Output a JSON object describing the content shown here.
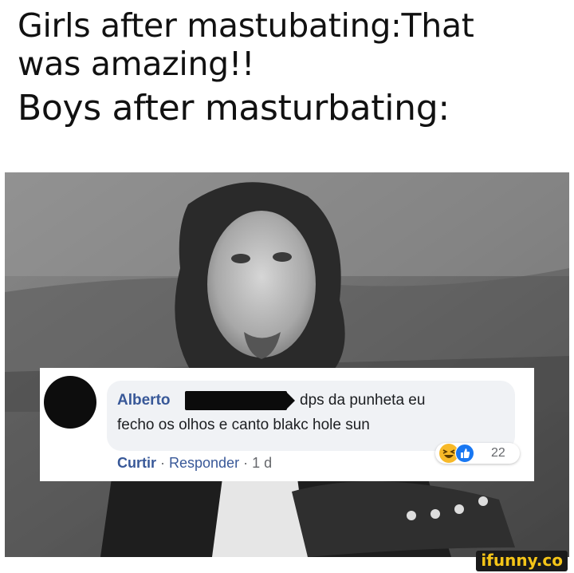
{
  "caption": {
    "line1": "Girls after mastubating:That",
    "line2": "was amazing!!",
    "line3": "Boys after masturbating:"
  },
  "comment": {
    "author": "Alberto",
    "text_line1": "dps da punheta eu",
    "text_line2": "fecho os olhos e canto blakc hole sun",
    "like_label": "Curtir",
    "separator": " · ",
    "reply_label": "Responder",
    "time": "1 d",
    "reaction_count": "22",
    "reactions": [
      "haha-icon",
      "like-icon"
    ]
  },
  "watermark": "ifunny.co",
  "colors": {
    "link_blue": "#385898",
    "bubble_bg": "#f0f2f5",
    "haha_yellow": "#f7b928",
    "like_blue": "#1877f2"
  }
}
